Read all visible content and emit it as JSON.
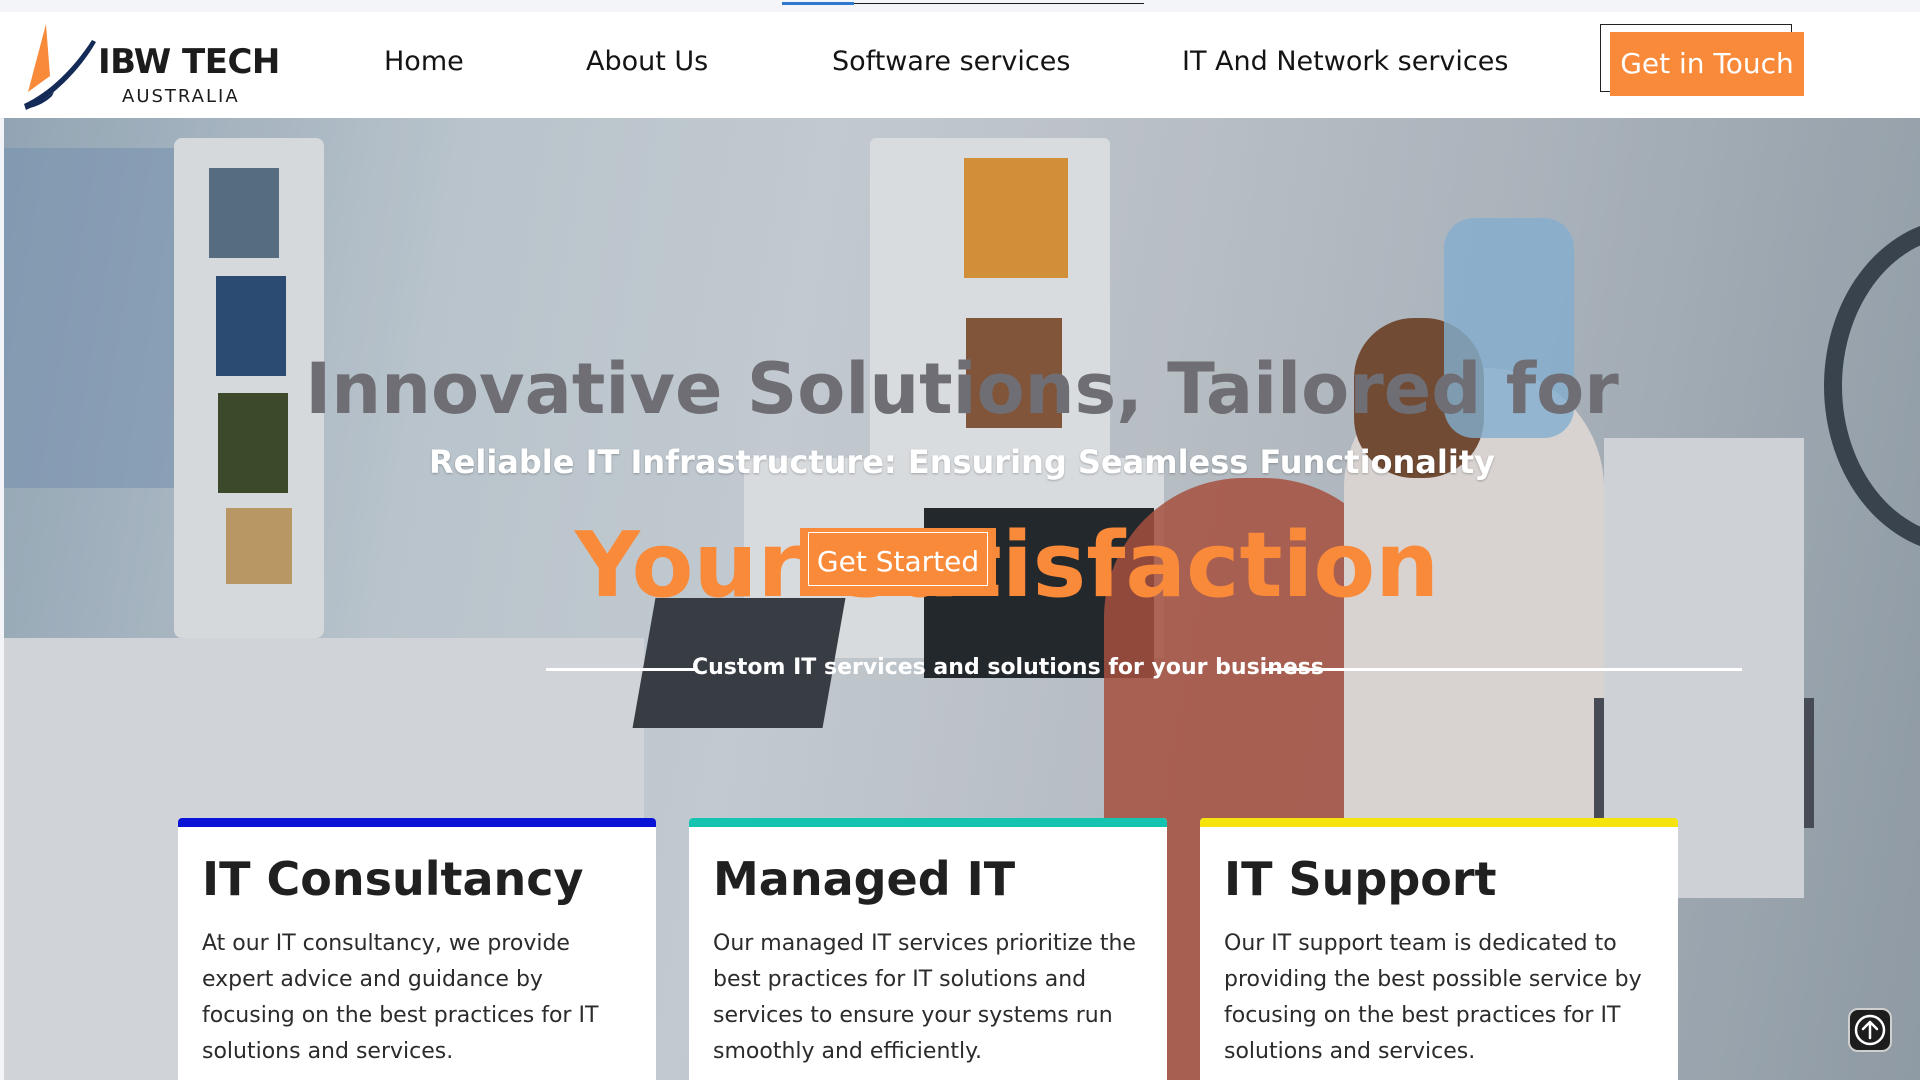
{
  "brand": {
    "name": "IBW TECH",
    "subtitle": "AUSTRALIA",
    "colors": {
      "orange": "#f98a3a",
      "navy": "#142a57"
    }
  },
  "nav": {
    "items": [
      {
        "label": "Home"
      },
      {
        "label": "About Us"
      },
      {
        "label": "Software services"
      },
      {
        "label": "IT And Network services"
      }
    ],
    "cta_label": "Get in Touch"
  },
  "hero": {
    "title": "Innovative Solutions, Tailored for",
    "subtitle": "Reliable IT Infrastructure: Ensuring Seamless Functionality",
    "accent": "Your Satisfaction",
    "button_label": "Get Started",
    "tagline": "Custom IT services and solutions for your business"
  },
  "cards": [
    {
      "title": "IT Consultancy",
      "text": "At our IT consultancy, we provide expert advice and guidance by focusing on the best practices for IT solutions and services.",
      "accent_color": "#0a14d6"
    },
    {
      "title": "Managed IT",
      "text": "Our managed IT services prioritize the best practices for IT solutions and services to ensure your systems run smoothly and efficiently.",
      "accent_color": "#14c4b0"
    },
    {
      "title": "IT Support",
      "text": "Our IT support team is dedicated to providing the best possible service by focusing on the best practices for IT solutions and services.",
      "accent_color": "#f4e40c"
    }
  ],
  "scroll_top_icon": "arrow-up-circle-icon"
}
